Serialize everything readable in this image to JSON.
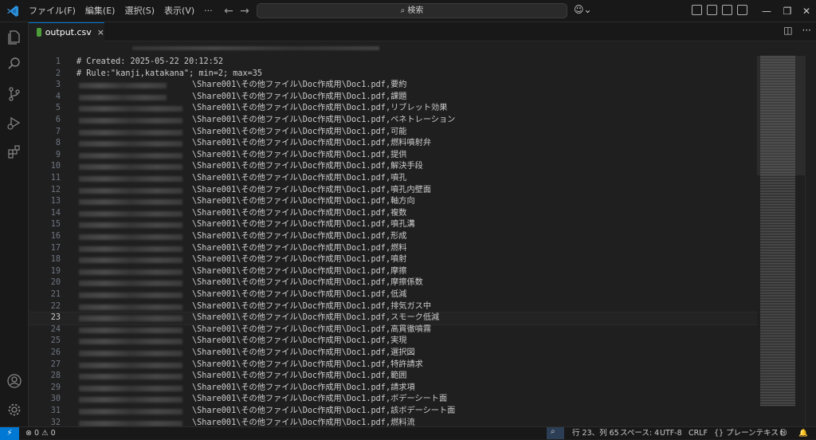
{
  "menu": [
    "ファイル(F)",
    "編集(E)",
    "選択(S)",
    "表示(V)",
    "···"
  ],
  "search": {
    "text": "検索"
  },
  "tab": {
    "name": "output.csv",
    "close": "×"
  },
  "editor": {
    "current_line": 23,
    "lines": [
      {
        "n": "1",
        "text": "# Created: 2025-05-22 20:12:52"
      },
      {
        "n": "2",
        "text": "# Rule:\"kanji,katakana\"; min=2; max=35"
      },
      {
        "n": "3",
        "text": "\\Share001\\その他ファイル\\Doc作成用\\Doc1.pdf,要約"
      },
      {
        "n": "4",
        "text": "\\Share001\\その他ファイル\\Doc作成用\\Doc1.pdf,課題"
      },
      {
        "n": "5",
        "text": "\\Share001\\その他ファイル\\Doc作成用\\Doc1.pdf,リブレット効果"
      },
      {
        "n": "6",
        "text": "\\Share001\\その他ファイル\\Doc作成用\\Doc1.pdf,ペネトレーション"
      },
      {
        "n": "7",
        "text": "\\Share001\\その他ファイル\\Doc作成用\\Doc1.pdf,可能"
      },
      {
        "n": "8",
        "text": "\\Share001\\その他ファイル\\Doc作成用\\Doc1.pdf,燃料噴射弁"
      },
      {
        "n": "9",
        "text": "\\Share001\\その他ファイル\\Doc作成用\\Doc1.pdf,提供"
      },
      {
        "n": "10",
        "text": "\\Share001\\その他ファイル\\Doc作成用\\Doc1.pdf,解決手段"
      },
      {
        "n": "11",
        "text": "\\Share001\\その他ファイル\\Doc作成用\\Doc1.pdf,噴孔"
      },
      {
        "n": "12",
        "text": "\\Share001\\その他ファイル\\Doc作成用\\Doc1.pdf,噴孔内壁面"
      },
      {
        "n": "13",
        "text": "\\Share001\\その他ファイル\\Doc作成用\\Doc1.pdf,軸方向"
      },
      {
        "n": "14",
        "text": "\\Share001\\その他ファイル\\Doc作成用\\Doc1.pdf,複数"
      },
      {
        "n": "15",
        "text": "\\Share001\\その他ファイル\\Doc作成用\\Doc1.pdf,噴孔溝"
      },
      {
        "n": "16",
        "text": "\\Share001\\その他ファイル\\Doc作成用\\Doc1.pdf,形成"
      },
      {
        "n": "17",
        "text": "\\Share001\\その他ファイル\\Doc作成用\\Doc1.pdf,燃料"
      },
      {
        "n": "18",
        "text": "\\Share001\\その他ファイル\\Doc作成用\\Doc1.pdf,噴射"
      },
      {
        "n": "19",
        "text": "\\Share001\\その他ファイル\\Doc作成用\\Doc1.pdf,摩擦"
      },
      {
        "n": "20",
        "text": "\\Share001\\その他ファイル\\Doc作成用\\Doc1.pdf,摩擦係数"
      },
      {
        "n": "21",
        "text": "\\Share001\\その他ファイル\\Doc作成用\\Doc1.pdf,低減"
      },
      {
        "n": "22",
        "text": "\\Share001\\その他ファイル\\Doc作成用\\Doc1.pdf,排気ガス中"
      },
      {
        "n": "23",
        "text": "\\Share001\\その他ファイル\\Doc作成用\\Doc1.pdf,スモーク低減"
      },
      {
        "n": "24",
        "text": "\\Share001\\その他ファイル\\Doc作成用\\Doc1.pdf,高貫徹噴霧"
      },
      {
        "n": "25",
        "text": "\\Share001\\その他ファイル\\Doc作成用\\Doc1.pdf,実現"
      },
      {
        "n": "26",
        "text": "\\Share001\\その他ファイル\\Doc作成用\\Doc1.pdf,選択図"
      },
      {
        "n": "27",
        "text": "\\Share001\\その他ファイル\\Doc作成用\\Doc1.pdf,特許請求"
      },
      {
        "n": "28",
        "text": "\\Share001\\その他ファイル\\Doc作成用\\Doc1.pdf,範囲"
      },
      {
        "n": "29",
        "text": "\\Share001\\その他ファイル\\Doc作成用\\Doc1.pdf,請求項"
      },
      {
        "n": "30",
        "text": "\\Share001\\その他ファイル\\Doc作成用\\Doc1.pdf,ボデーシート面"
      },
      {
        "n": "31",
        "text": "\\Share001\\その他ファイル\\Doc作成用\\Doc1.pdf,該ボデーシート面"
      },
      {
        "n": "32",
        "text": "\\Share001\\その他ファイル\\Doc作成用\\Doc1.pdf,燃料流"
      }
    ]
  },
  "status": {
    "errors": "0",
    "warnings": "0",
    "position": "行 23、列 65",
    "spaces": "スペース: 4",
    "encoding": "UTF-8",
    "eol": "CRLF",
    "language_brace": "{}",
    "language": "プレーンテキスト"
  },
  "colors": {
    "accent": "#0078d4",
    "bg": "#1f1f1f"
  }
}
